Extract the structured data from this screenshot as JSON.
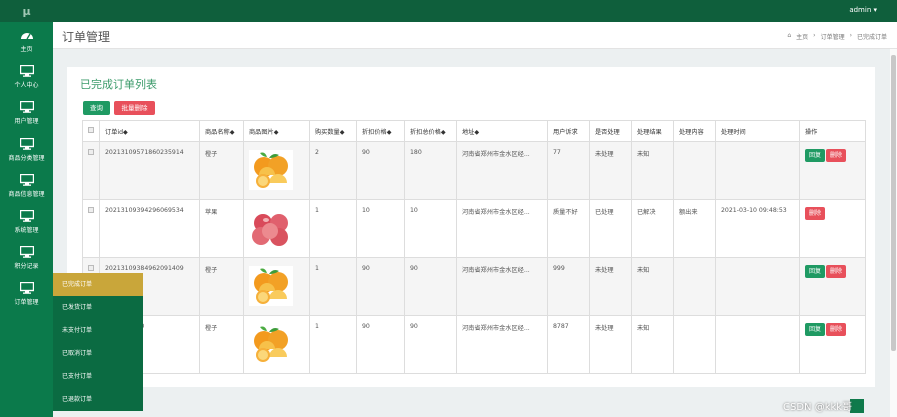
{
  "app": {
    "logo": "μ",
    "user": "admin ▾"
  },
  "sidebar": {
    "items": [
      {
        "label": "主页",
        "icon": "dashboard-icon"
      },
      {
        "label": "个人中心",
        "icon": "monitor-icon"
      },
      {
        "label": "用户管理",
        "icon": "monitor-icon"
      },
      {
        "label": "商品分类管理",
        "icon": "monitor-icon"
      },
      {
        "label": "商品信息管理",
        "icon": "monitor-icon"
      },
      {
        "label": "系统管理",
        "icon": "monitor-icon"
      },
      {
        "label": "积分记录",
        "icon": "monitor-icon"
      },
      {
        "label": "订单管理",
        "icon": "monitor-icon"
      }
    ],
    "submenu": [
      "已完成订单",
      "已发货订单",
      "未支付订单",
      "已取消订单",
      "已支付订单",
      "已退款订单"
    ]
  },
  "header": {
    "title": "订单管理",
    "breadcrumbs": [
      "主页",
      "›",
      "订单管理",
      "›",
      "已完成订单"
    ]
  },
  "card": {
    "title": "已完成订单列表",
    "query_label": "查询",
    "batch_delete_label": "批量删除"
  },
  "table": {
    "headers": [
      "订单id◆",
      "商品名称◆",
      "商品图片◆",
      "购买数量◆",
      "折扣价格◆",
      "折扣总价格◆",
      "地址◆",
      "用户诉求",
      "是否处理",
      "处理结果",
      "处理内容",
      "处理时间",
      "操作"
    ],
    "rows": [
      {
        "id": "20213109571860235914",
        "name": "橙子",
        "fruit": "orange",
        "qty": "2",
        "price": "90",
        "total": "180",
        "address": "河南省郑州市金水区经...",
        "appeal": "77",
        "handled": "未处理",
        "result": "未知",
        "content": "",
        "time": "",
        "has_reply": true
      },
      {
        "id": "20213109394296069534",
        "name": "苹果",
        "fruit": "apple",
        "qty": "1",
        "price": "10",
        "total": "10",
        "address": "河南省郑州市金水区经...",
        "appeal": "质量不好",
        "handled": "已处理",
        "result": "已解决",
        "content": "额出来",
        "time": "2021-03-10 09:48:53",
        "has_reply": false
      },
      {
        "id": "20213109384962091409",
        "name": "橙子",
        "fruit": "orange",
        "qty": "1",
        "price": "90",
        "total": "90",
        "address": "河南省郑州市金水区经...",
        "appeal": "999",
        "handled": "未处理",
        "result": "未知",
        "content": "",
        "time": "",
        "has_reply": true
      },
      {
        "id": "2281860060",
        "name": "橙子",
        "fruit": "orange",
        "qty": "1",
        "price": "90",
        "total": "90",
        "address": "河南省郑州市金水区经...",
        "appeal": "8787",
        "handled": "未处理",
        "result": "未知",
        "content": "",
        "time": "",
        "has_reply": true
      }
    ],
    "reply_label": "回复",
    "delete_label": "删除"
  },
  "watermark": "CSDN @kkk哥",
  "colors": {
    "topbar": "#0f5f3c",
    "sidebar": "#0b7a4b",
    "accent": "#1f9a63",
    "danger": "#e8505b",
    "submenu_active": "#c9a63a"
  }
}
